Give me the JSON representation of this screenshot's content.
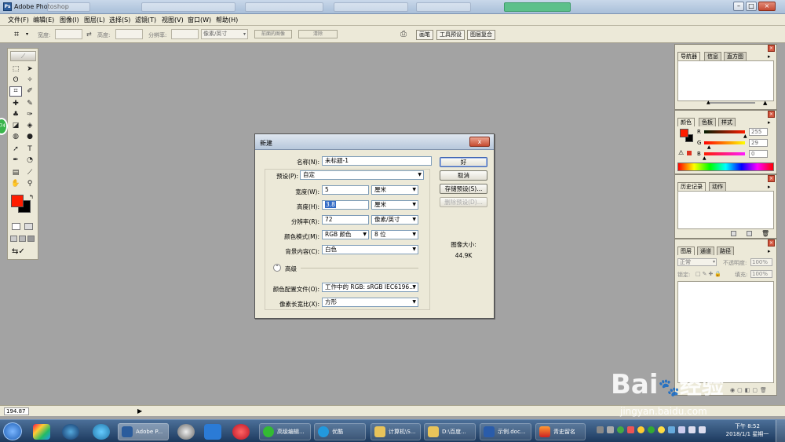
{
  "app": {
    "title": "Adobe Photoshop",
    "icon_text": "Ps"
  },
  "menu": [
    "文件(F)",
    "编辑(E)",
    "图像(I)",
    "图层(L)",
    "选择(S)",
    "滤镜(T)",
    "视图(V)",
    "窗口(W)",
    "帮助(H)"
  ],
  "options_bar": {
    "width_label": "宽度:",
    "height_label": "高度:",
    "resolution_label": "分辨率:",
    "unit_value": "像素/英寸",
    "front_image_button": "前面的图像",
    "clear_button": "清除"
  },
  "palette_well": [
    "画笔",
    "工具预设",
    "图层复合"
  ],
  "panels": {
    "navigator": [
      "导航器",
      "信息",
      "直方图"
    ],
    "color": {
      "tabs": [
        "颜色",
        "色板",
        "样式"
      ],
      "r_label": "R",
      "g_label": "G",
      "b_label": "B",
      "r_value": "255",
      "g_value": "29",
      "b_value": "0",
      "r_fraction": 1.0,
      "g_fraction": 0.114,
      "b_fraction": 0.0
    },
    "history": [
      "历史记录",
      "动作"
    ],
    "layers": {
      "tabs": [
        "图层",
        "通道",
        "路径"
      ],
      "blend_mode": "正常",
      "opacity_label": "不透明度:",
      "opacity_value": "100%",
      "lock_label": "锁定:",
      "fill_label": "填充:",
      "fill_value": "100%"
    }
  },
  "status": {
    "zoom": "194.87"
  },
  "dialog": {
    "title": "新建",
    "close_glyph": "x",
    "name_label": "名称(N):",
    "name_value": "未标题-1",
    "preset_label": "预设(P):",
    "preset_value": "自定",
    "width_label": "宽度(W):",
    "width_value": "5",
    "width_unit": "厘米",
    "height_label": "高度(H):",
    "height_value": "3.8",
    "height_unit": "厘米",
    "resolution_label": "分辨率(R):",
    "resolution_value": "72",
    "resolution_unit": "像素/英寸",
    "color_mode_label": "颜色模式(M):",
    "color_mode_value": "RGB 颜色",
    "bit_depth_value": "8 位",
    "background_label": "背景内容(C):",
    "background_value": "白色",
    "advanced_label": "高级",
    "profile_label": "颜色配置文件(O):",
    "profile_value": "工作中的 RGB: sRGB IEC6196...",
    "aspect_label": "像素长宽比(X):",
    "aspect_value": "方形",
    "ok_button": "好",
    "cancel_button": "取消",
    "save_preset_button": "存储预设(S)...",
    "delete_preset_button": "删除预设(D)...",
    "image_size_label": "图像大小:",
    "image_size_value": "44.9K"
  },
  "taskbar": {
    "items": [
      "Adobe P...",
      "高级编辑...",
      "优酷",
      "计算机\\S...",
      "D:\\百度...",
      "示例.doc...",
      "青史留名"
    ],
    "clock_time": "下午 8:52",
    "clock_date": "2018/1/1 星期一"
  },
  "watermark": {
    "brand": "Bai",
    "brand_suffix": "经验",
    "url": "jingyan.baidu.com"
  },
  "colors": {
    "foreground": "#ff1d00",
    "background": "#000000",
    "workspace": "#a3a3a3",
    "chrome": "#ece9d8",
    "accent_green": "#39b44a"
  },
  "side_bubble": "74"
}
